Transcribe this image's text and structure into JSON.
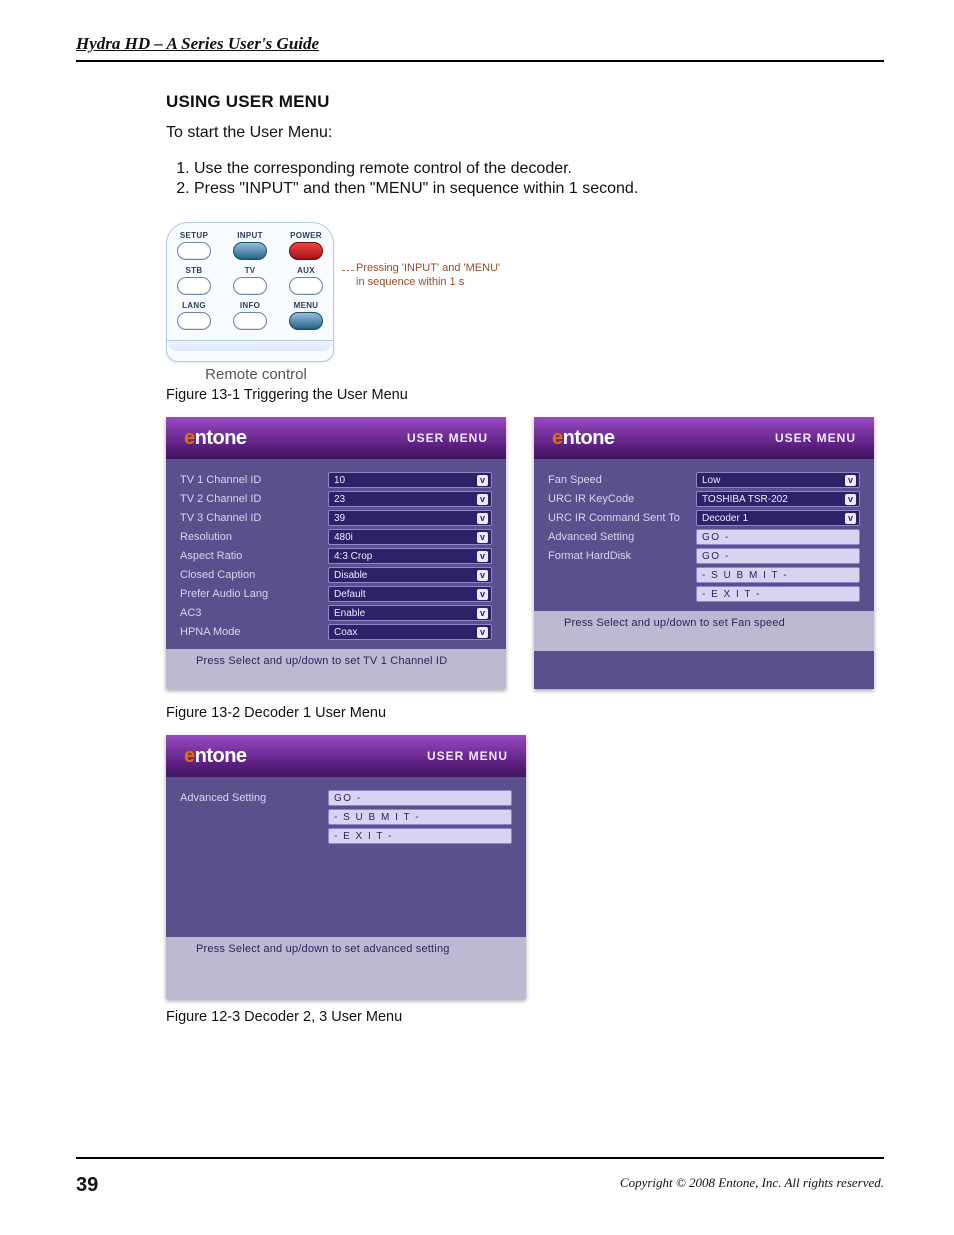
{
  "header": {
    "running": "Hydra HD – A Series User's Guide"
  },
  "section": {
    "title": "USING USER MENU",
    "intro": "To start the User Menu:"
  },
  "steps": [
    "Use the corresponding remote control of the decoder.",
    "Press \"INPUT\" and then \"MENU\" in sequence within 1 second."
  ],
  "remote": {
    "row1": [
      "SETUP",
      "INPUT",
      "POWER"
    ],
    "row2": [
      "STB",
      "TV",
      "AUX"
    ],
    "row3": [
      "LANG",
      "INFO",
      "MENU"
    ],
    "note": "Pressing 'INPUT' and 'MENU' in sequence within 1 s",
    "caption": "Remote control",
    "fig": "Figure 13-1 Triggering the User Menu"
  },
  "menu1": {
    "brand_e": "e",
    "brand": "ntone",
    "title": "USER MENU",
    "rows": [
      {
        "label": "TV 1 Channel ID",
        "value": "10",
        "drop": true
      },
      {
        "label": "TV 2 Channel ID",
        "value": "23",
        "drop": true
      },
      {
        "label": "TV 3 Channel ID",
        "value": "39",
        "drop": true
      },
      {
        "label": "Resolution",
        "value": "480i",
        "drop": true
      },
      {
        "label": "Aspect Ratio",
        "value": "4:3 Crop",
        "drop": true
      },
      {
        "label": "Closed Caption",
        "value": "Disable",
        "drop": true
      },
      {
        "label": "Prefer Audio Lang",
        "value": "Default",
        "drop": true
      },
      {
        "label": "AC3",
        "value": "Enable",
        "drop": true
      },
      {
        "label": "HPNA Mode",
        "value": "Coax",
        "drop": true
      }
    ],
    "help": "Press Select and up/down to set TV 1 Channel ID"
  },
  "menu2": {
    "brand_e": "e",
    "brand": "ntone",
    "title": "USER MENU",
    "rows": [
      {
        "label": "Fan Speed",
        "value": "Low",
        "drop": true
      },
      {
        "label": "URC IR KeyCode",
        "value": "TOSHIBA TSR-202",
        "drop": true
      },
      {
        "label": "URC IR Command Sent To",
        "value": "Decoder 1",
        "drop": true
      },
      {
        "label": "Advanced Setting",
        "value": "GO -",
        "button": true
      },
      {
        "label": "Format HardDisk",
        "value": "GO -",
        "button": true
      },
      {
        "label": "",
        "value": "- S U B M I T -",
        "button": true
      },
      {
        "label": "",
        "value": "- E X I T -",
        "button": true
      }
    ],
    "help": "Press Select and up/down to set Fan speed"
  },
  "fig2": "Figure 13-2 Decoder 1 User Menu",
  "menu3": {
    "brand_e": "e",
    "brand": "ntone",
    "title": "USER MENU",
    "rows": [
      {
        "label": "Advanced Setting",
        "value": "GO -",
        "button": true
      },
      {
        "label": "",
        "value": "- S U B M I T -",
        "button": true
      },
      {
        "label": "",
        "value": "- E X I T -",
        "button": true
      }
    ],
    "help": "Press Select and up/down to set advanced setting"
  },
  "fig3": "Figure 12-3 Decoder 2, 3 User Menu",
  "footer": {
    "page": "39",
    "copyright": "Copyright © 2008 Entone, Inc. All rights reserved."
  }
}
